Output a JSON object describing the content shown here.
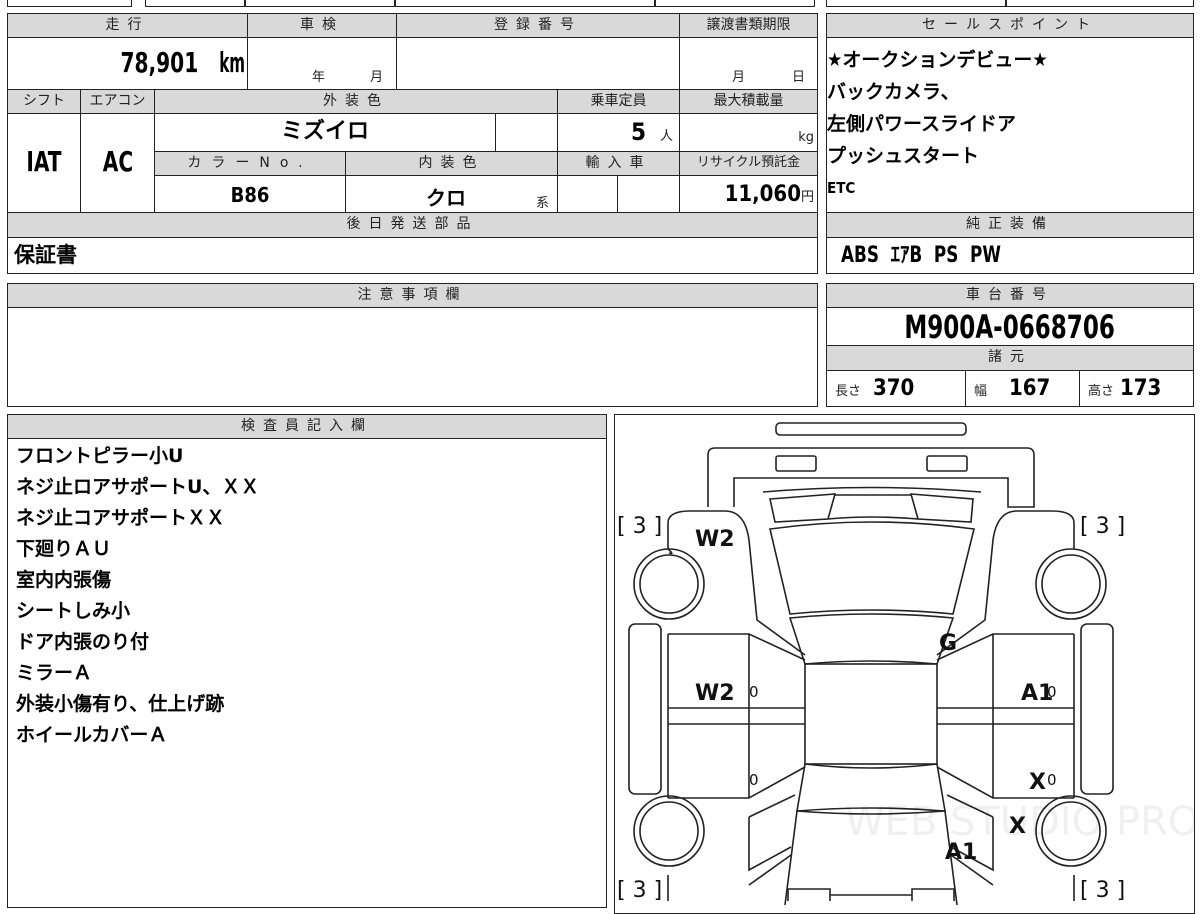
{
  "vehicle": {
    "mileage_label": "走行",
    "mileage": "78,901",
    "mileage_unit": "km",
    "shaken_label": "車検",
    "shaken_year": "年",
    "shaken_month": "月",
    "reg_label": "登録番号",
    "transfer_label": "譲渡書類期限",
    "transfer_month": "月",
    "transfer_day": "日",
    "shift_label": "シフト",
    "shift": "IAT",
    "ac_label": "エアコン",
    "ac": "AC",
    "ext_color_label": "外装色",
    "ext_color": "ミズイロ",
    "capacity_label": "乗車定員",
    "capacity": "5",
    "capacity_unit": "人",
    "max_load_label": "最大積載量",
    "max_load_unit": "kg",
    "color_no_label": "カラーNo.",
    "color_no": "B86",
    "int_color_label": "内装色",
    "int_color": "クロ",
    "int_color_suffix": "系",
    "import_label": "輸入車",
    "recycle_label": "リサイクル預託金",
    "recycle": "11,060",
    "recycle_unit": "円",
    "later_parts_label": "後日発送部品",
    "later_parts": "保証書"
  },
  "sales_points": {
    "label": "セールスポイント",
    "items": [
      "★オークションデビュー★",
      "バックカメラ、",
      "左側パワースライドア",
      "プッシュスタート",
      "ETC"
    ]
  },
  "equipment": {
    "label": "純正装備",
    "value": "ABS  ｴｱB  PS  PW"
  },
  "notes": {
    "label": "注意事項欄"
  },
  "chassis": {
    "label": "車台番号",
    "value": "M900A-0668706"
  },
  "specs": {
    "label": "諸元",
    "length_label": "長さ",
    "length": "370",
    "width_label": "幅",
    "width": "167",
    "height_label": "高さ",
    "height": "173"
  },
  "inspector": {
    "label": "検査員記入欄",
    "lines": [
      "フロントピラー小U",
      "ネジ止ロアサポートU、ＸＸ",
      "ネジ止コアサポートＸＸ",
      "下廻りＡＵ",
      "室内内張傷",
      "シートしみ小",
      "ドア内張のり付",
      "ミラーＡ",
      "外装小傷有り、仕上げ跡",
      "ホイールカバーＡ"
    ]
  },
  "diagram": {
    "tire_marks": [
      "[ 3 ]",
      "[ 3 ]",
      "[ 3 ]",
      "[ 3 ]"
    ],
    "marks": {
      "front_left_fender": "W2",
      "roof": "G",
      "left_front_door": "W2",
      "right_front_door": "A1",
      "right_rear_door": "X",
      "right_rear_fender": "X",
      "trunk": "A1",
      "door_zero_1": "0",
      "door_zero_2": "0",
      "door_zero_3": "0",
      "door_zero_4": "0"
    },
    "watermark": "WEB STUDIO PRO"
  }
}
